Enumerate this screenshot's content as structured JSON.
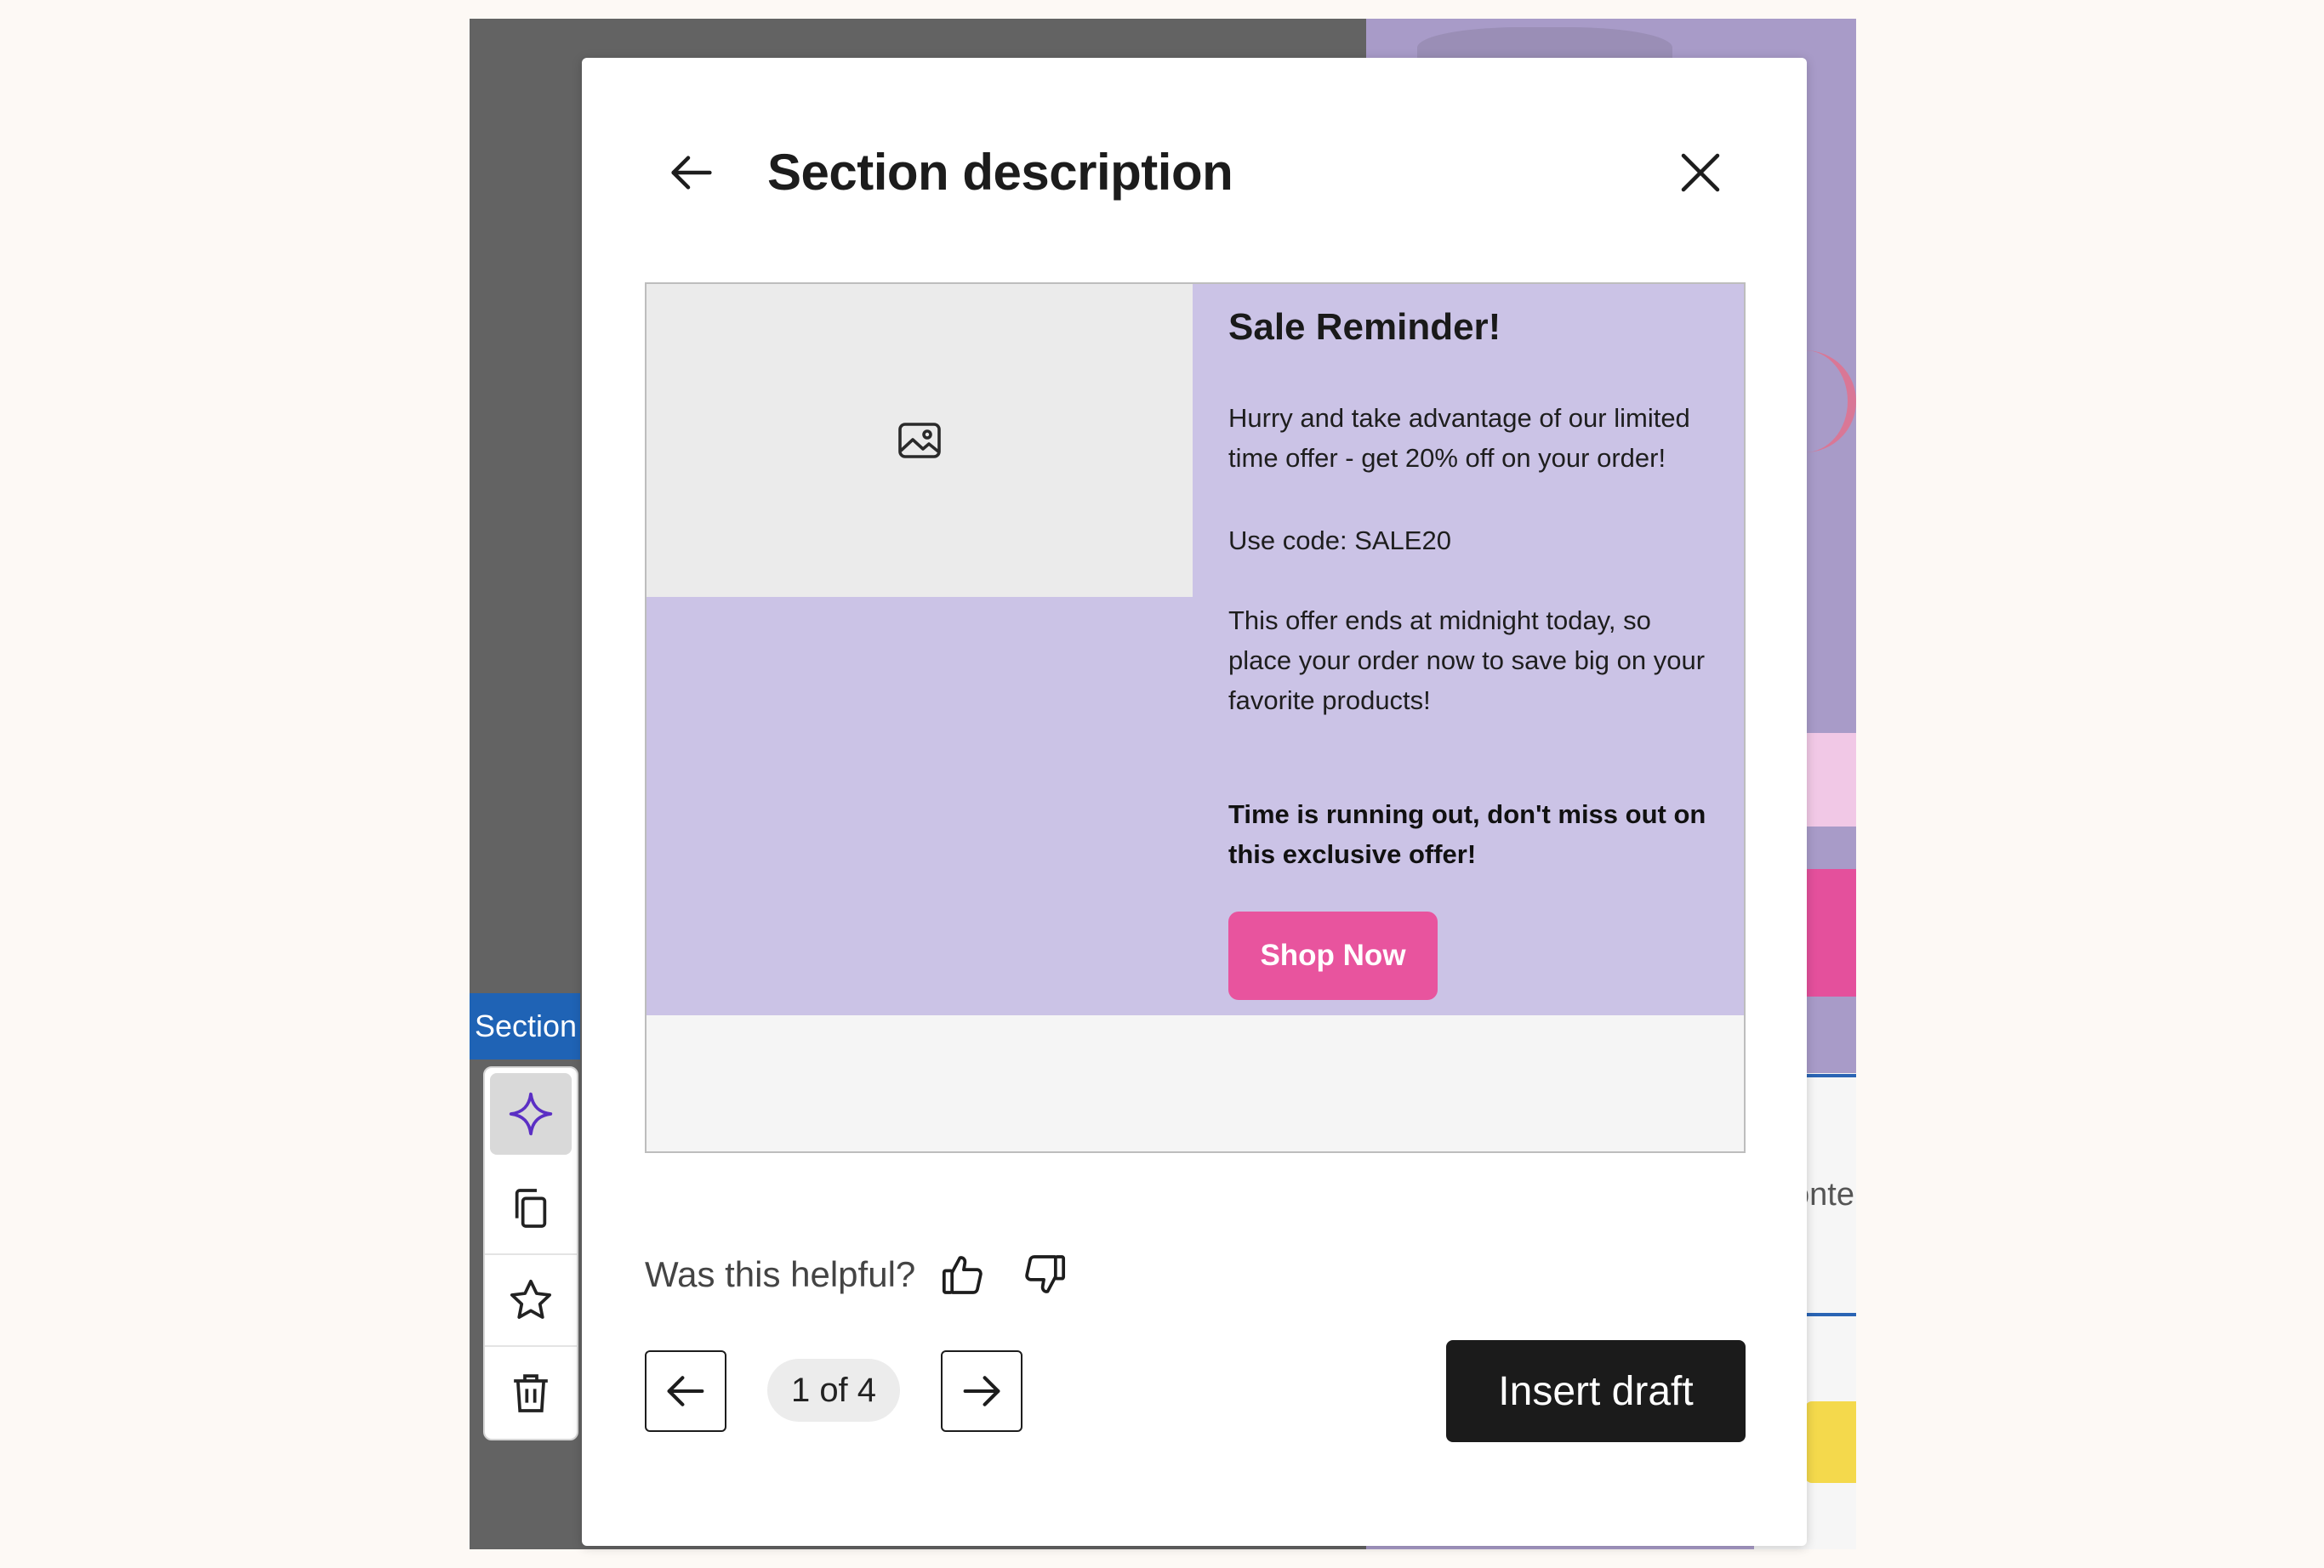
{
  "background": {
    "section_tab_label": "Section",
    "partial_text": "onte",
    "toolbar": {
      "items": [
        {
          "name": "ai-sparkle",
          "icon": "sparkle-icon",
          "active": true
        },
        {
          "name": "duplicate",
          "icon": "copy-icon"
        },
        {
          "name": "favorite",
          "icon": "star-icon"
        },
        {
          "name": "delete",
          "icon": "trash-icon"
        }
      ]
    }
  },
  "modal": {
    "title": "Section description",
    "back_icon": "arrow-left-icon",
    "close_icon": "close-icon",
    "preview": {
      "image_icon": "image-icon",
      "heading": "Sale Reminder!",
      "paragraph1": "Hurry and take advantage of our limited time offer - get 20% off on your order!",
      "paragraph2": "Use code: SALE20",
      "paragraph3": "This offer ends at midnight today, so place your order now to save big on your favorite products!",
      "paragraph4": "Time is running out, don't miss out on this exclusive offer!",
      "button_label": "Shop Now"
    },
    "feedback": {
      "label": "Was this helpful?",
      "thumbs_up_icon": "thumbs-up-icon",
      "thumbs_down_icon": "thumbs-down-icon"
    },
    "pagination": {
      "indicator": "1 of 4",
      "prev_icon": "arrow-left-icon",
      "next_icon": "arrow-right-icon"
    },
    "insert_label": "Insert draft"
  },
  "colors": {
    "email_background": "#cbc3e6",
    "shop_button": "#e8549e",
    "insert_button": "#1b1b1b",
    "section_tab": "#1f63b5",
    "sparkle_accent": "#5b2fc4"
  }
}
